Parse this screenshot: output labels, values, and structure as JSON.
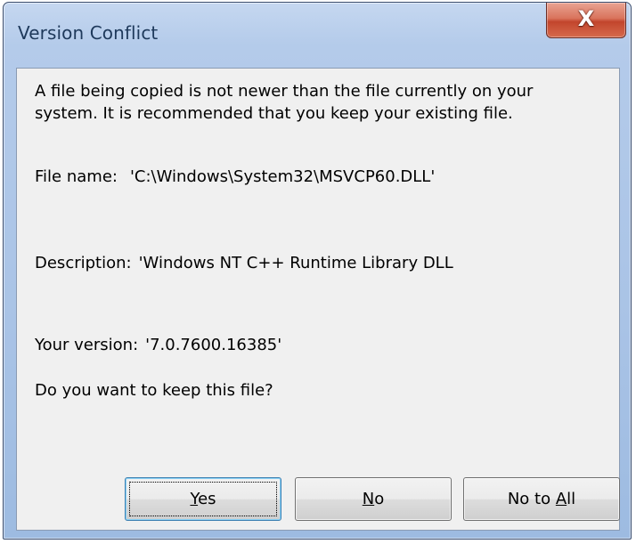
{
  "window": {
    "title": "Version Conflict",
    "close_label": "X"
  },
  "message": {
    "line1": "A file being copied is not newer than the file currently on your",
    "line2": "system. It is recommended that you keep your existing file."
  },
  "details": {
    "file_name_label": "File name:",
    "file_name_value": "'C:\\Windows\\System32\\MSVCP60.DLL'",
    "description_label": "Description:",
    "description_value": "'Windows NT C++ Runtime Library DLL",
    "version_label": "Your version:",
    "version_value": "'7.0.7600.16385'"
  },
  "question": "Do you want to keep this file?",
  "buttons": {
    "yes": {
      "label": "Yes",
      "accel": "Y",
      "rest": "es"
    },
    "no": {
      "label": "No",
      "accel": "N",
      "rest": "o"
    },
    "no_to_all": {
      "label": "No to All",
      "prefix": "No to ",
      "accel": "A",
      "rest": "ll"
    }
  }
}
